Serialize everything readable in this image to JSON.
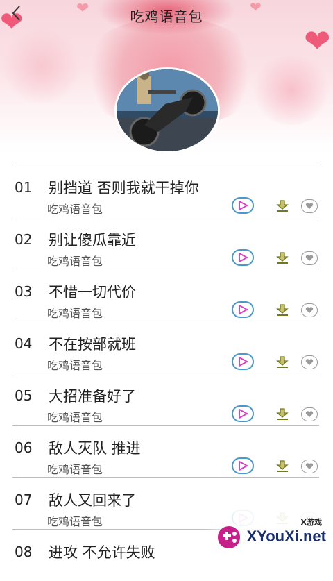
{
  "header": {
    "title": "吃鸡语音包",
    "back_icon": "chevron-left-icon"
  },
  "colors": {
    "play_border": "#4a98c9",
    "play_triangle": "#d447c0",
    "download": "#6f7a1c",
    "watermark_text": "#1a2f6b"
  },
  "list": {
    "items": [
      {
        "num": "01",
        "title": "别挡道 否则我就干掉你",
        "sub": "吃鸡语音包"
      },
      {
        "num": "02",
        "title": "别让傻瓜靠近",
        "sub": "吃鸡语音包"
      },
      {
        "num": "03",
        "title": "不惜一切代价",
        "sub": "吃鸡语音包"
      },
      {
        "num": "04",
        "title": "不在按部就班",
        "sub": "吃鸡语音包"
      },
      {
        "num": "05",
        "title": "大招准备好了",
        "sub": "吃鸡语音包"
      },
      {
        "num": "06",
        "title": "敌人灭队 推进",
        "sub": "吃鸡语音包"
      },
      {
        "num": "07",
        "title": "敌人又回来了",
        "sub": "吃鸡语音包"
      },
      {
        "num": "08",
        "title": "进攻 不允许失败",
        "sub": ""
      }
    ]
  },
  "watermark": {
    "small_text": "X游戏",
    "big_text": "XYouXi.net"
  }
}
